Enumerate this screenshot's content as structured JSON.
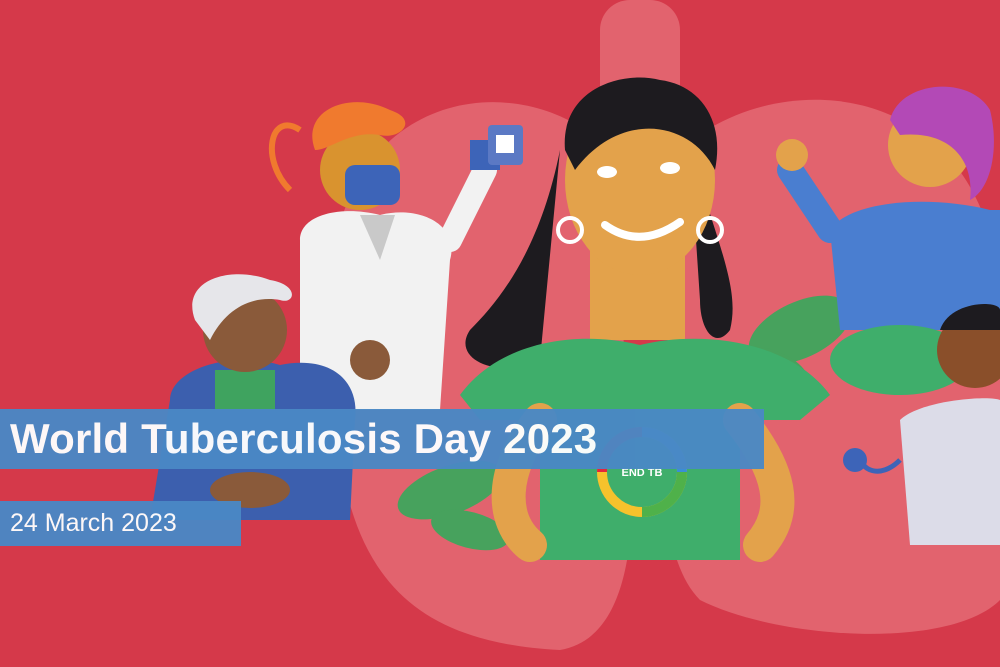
{
  "banner": {
    "title": "World Tuberculosis Day 2023",
    "date": "24 March 2023",
    "badge": "END TB"
  },
  "colors": {
    "background": "#d5394a",
    "lungs": "#e0656f",
    "title_band": "#4a88c5",
    "shirt_green": "#3fae6b",
    "skin": "#e3a24b"
  }
}
